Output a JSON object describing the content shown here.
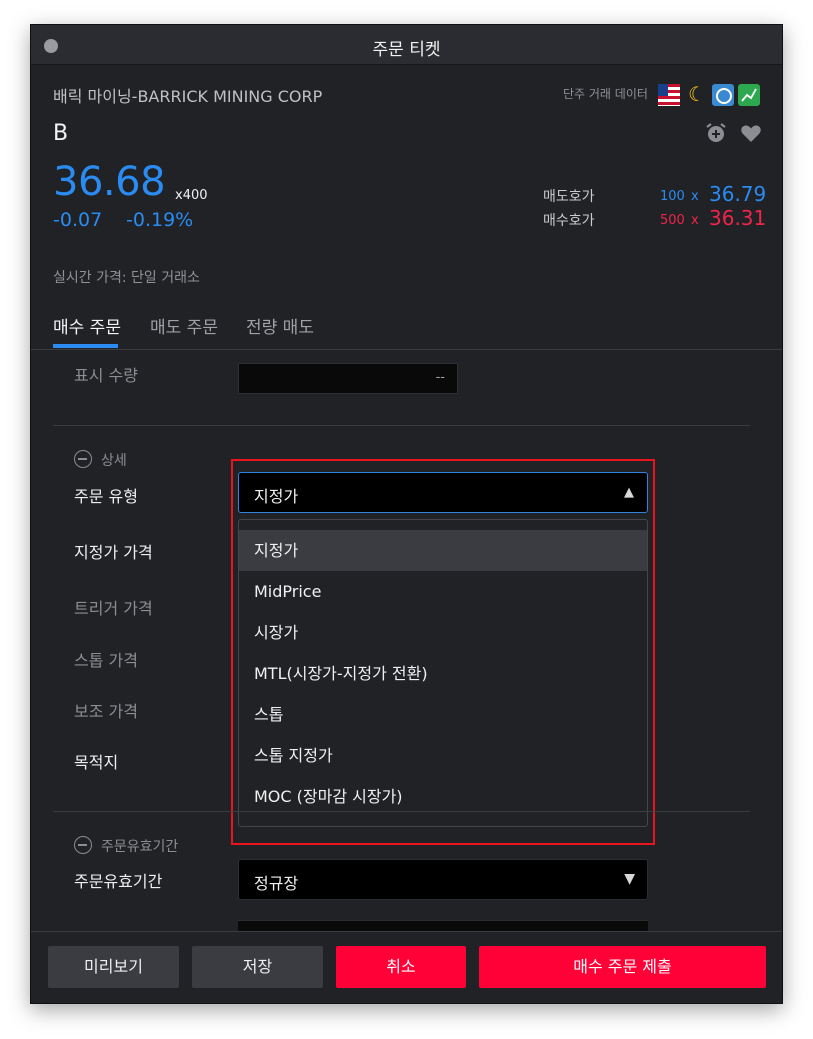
{
  "window": {
    "title": "주문 티켓"
  },
  "header": {
    "company": "배릭 마이닝-BARRICK MINING CORP",
    "ticker": "B",
    "trade_data_label": "단주 거래 데이터",
    "icons": [
      "us-flag-icon",
      "moon-icon",
      "clock-icon",
      "chart-icon",
      "alarm-add-icon",
      "heart-icon"
    ]
  },
  "quote": {
    "last": "36.68",
    "multiplier": "x400",
    "change": "-0.07",
    "change_pct": "-0.19%",
    "ask": {
      "label": "매도호가",
      "size": "100",
      "x": "x",
      "price": "36.79"
    },
    "bid": {
      "label": "매수호가",
      "size": "500",
      "x": "x",
      "price": "36.31"
    },
    "realtime_note": "실시간 가격: 단일 거래소",
    "colors": {
      "up_blue": "#2a8cf2",
      "down_red": "#f0244a"
    }
  },
  "tabs": [
    {
      "label": "매수 주문",
      "active": true
    },
    {
      "label": "매도 주문",
      "active": false
    },
    {
      "label": "전량 매도",
      "active": false
    }
  ],
  "form": {
    "display_qty": {
      "label": "표시 수량",
      "value": "--"
    },
    "detail_section": "상세",
    "order_type": {
      "label": "주문 유형",
      "value": "지정가"
    },
    "limit_price_label": "지정가 가격",
    "trigger_price_label": "트리거 가격",
    "stop_price_label": "스톱 가격",
    "aux_price_label": "보조 가격",
    "destination_label": "목적지",
    "dropdown_options": [
      "지정가",
      "MidPrice",
      "시장가",
      "MTL(시장가-지정가 전환)",
      "스톱",
      "스톱 지정가",
      "MOC (장마감 시장가)"
    ],
    "tif_section": "주문유효기간",
    "tif": {
      "label": "주문유효기간",
      "value": "정규장"
    }
  },
  "footer": {
    "preview": "미리보기",
    "save": "저장",
    "cancel": "취소",
    "submit": "매수 주문 제출",
    "accent": "#ff0037"
  },
  "annotation": {
    "highlight_color": "#e8151f"
  }
}
